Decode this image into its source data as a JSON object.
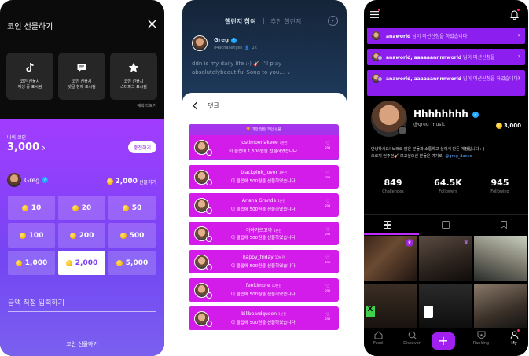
{
  "phone1": {
    "title": "코인 선물하기",
    "tools": [
      {
        "icon": "tiktok-icon",
        "line1": "코인 선물시",
        "line2": "재생 중 표시됨"
      },
      {
        "icon": "comment-icon",
        "line1": "코인 선물시",
        "line2": "댓글 창에 표시됨"
      },
      {
        "icon": "star-icon",
        "line1": "코인 선물시",
        "line2": "스타피크 표시됨"
      }
    ],
    "more": "혜택 더보기",
    "my_coin_label": "나의 코인",
    "my_coin_value": "3,000",
    "charge_label": "충전하기",
    "recipient_name": "Greg",
    "recipient_amount": "2,000",
    "recipient_amount_label": "선물하기",
    "amounts": [
      "10",
      "20",
      "50",
      "100",
      "200",
      "500",
      "1,000",
      "2,000",
      "5,000"
    ],
    "selected_amount": "2,000",
    "direct_input_placeholder": "금액 직접 입력하기",
    "gift_button": "코인 선물하기"
  },
  "phone2": {
    "tab_active": "챌린지 참여",
    "tab_separator": "|",
    "tab_inactive": "추천 챌린지",
    "user_name": "Greg",
    "user_challenges": "849challenges",
    "user_followers": "2k",
    "description": "ddn is my daily life :-) 🎸 I'll play absolutelybeautiful Song to you... ⌄",
    "comments_title": "댓글",
    "top_label": "가장 많은 코인 선물",
    "gifts": [
      {
        "name": "Justimberlakeee",
        "time": "1분전",
        "msg": "이 클립에 1,500원을 선물하였습니다.",
        "likes": "255"
      },
      {
        "name": "blackpink_lover",
        "time": "1분전",
        "msg": "이 클립에 500원을 선물하였습니다.",
        "likes": "255"
      },
      {
        "name": "Ariana Grande",
        "time": "1분전",
        "msg": "이 클립에 500원을 선물하였습니다.",
        "likes": "255"
      },
      {
        "name": "아아가르고야",
        "time": "1분전",
        "msg": "이 클립에 500원을 선물하였습니다.",
        "likes": "255"
      },
      {
        "name": "happy_friday",
        "time": "10분전",
        "msg": "이 클립에 500원을 선물하였습니다.",
        "likes": "255"
      },
      {
        "name": "feeltimbre",
        "time": "10분전",
        "msg": "이 클립에 500원을 선물하였습니다.",
        "likes": "255"
      },
      {
        "name": "billboardqueen",
        "time": "1분전",
        "msg": "이 클립에 500원을 선물하였습니다.",
        "likes": "255"
      }
    ]
  },
  "phone3": {
    "notifications": [
      {
        "user": "anaworld",
        "text": " 님이 미션신청을 하였습니다."
      },
      {
        "user": "anaworld, aaaaaannnnworld",
        "text": " 님이 미션신청을"
      },
      {
        "user": "anaworld, aaaaaannnnworld",
        "text": " 님이 미션신청을 하였습니다."
      }
    ],
    "display_name": "Hhhhhhhh",
    "handle": "@greg_music",
    "coins": "3,000",
    "bio_line1": "안녕하세요! 노래로 많은 분들과 소통하고 싶어서 만든 계정입니다 :-)",
    "bio_line2_pre": "오로지 언주먼🎸 보고싶으신 분들은 여기로! ",
    "bio_link": "@greg_dance",
    "stats": [
      {
        "value": "849",
        "label": "Challenges"
      },
      {
        "value": "64.5K",
        "label": "Followers"
      },
      {
        "value": "945",
        "label": "Following"
      }
    ],
    "nav": [
      {
        "icon": "home-icon",
        "label": "Feed"
      },
      {
        "icon": "discover-icon",
        "label": "Discover"
      },
      {
        "icon": "plus-icon",
        "label": ""
      },
      {
        "icon": "ranking-icon",
        "label": "Ranking"
      },
      {
        "icon": "profile-icon",
        "label": "My"
      }
    ],
    "colors": {
      "accent": "#8c1ef0",
      "tab_active": "#bf2cff"
    }
  }
}
